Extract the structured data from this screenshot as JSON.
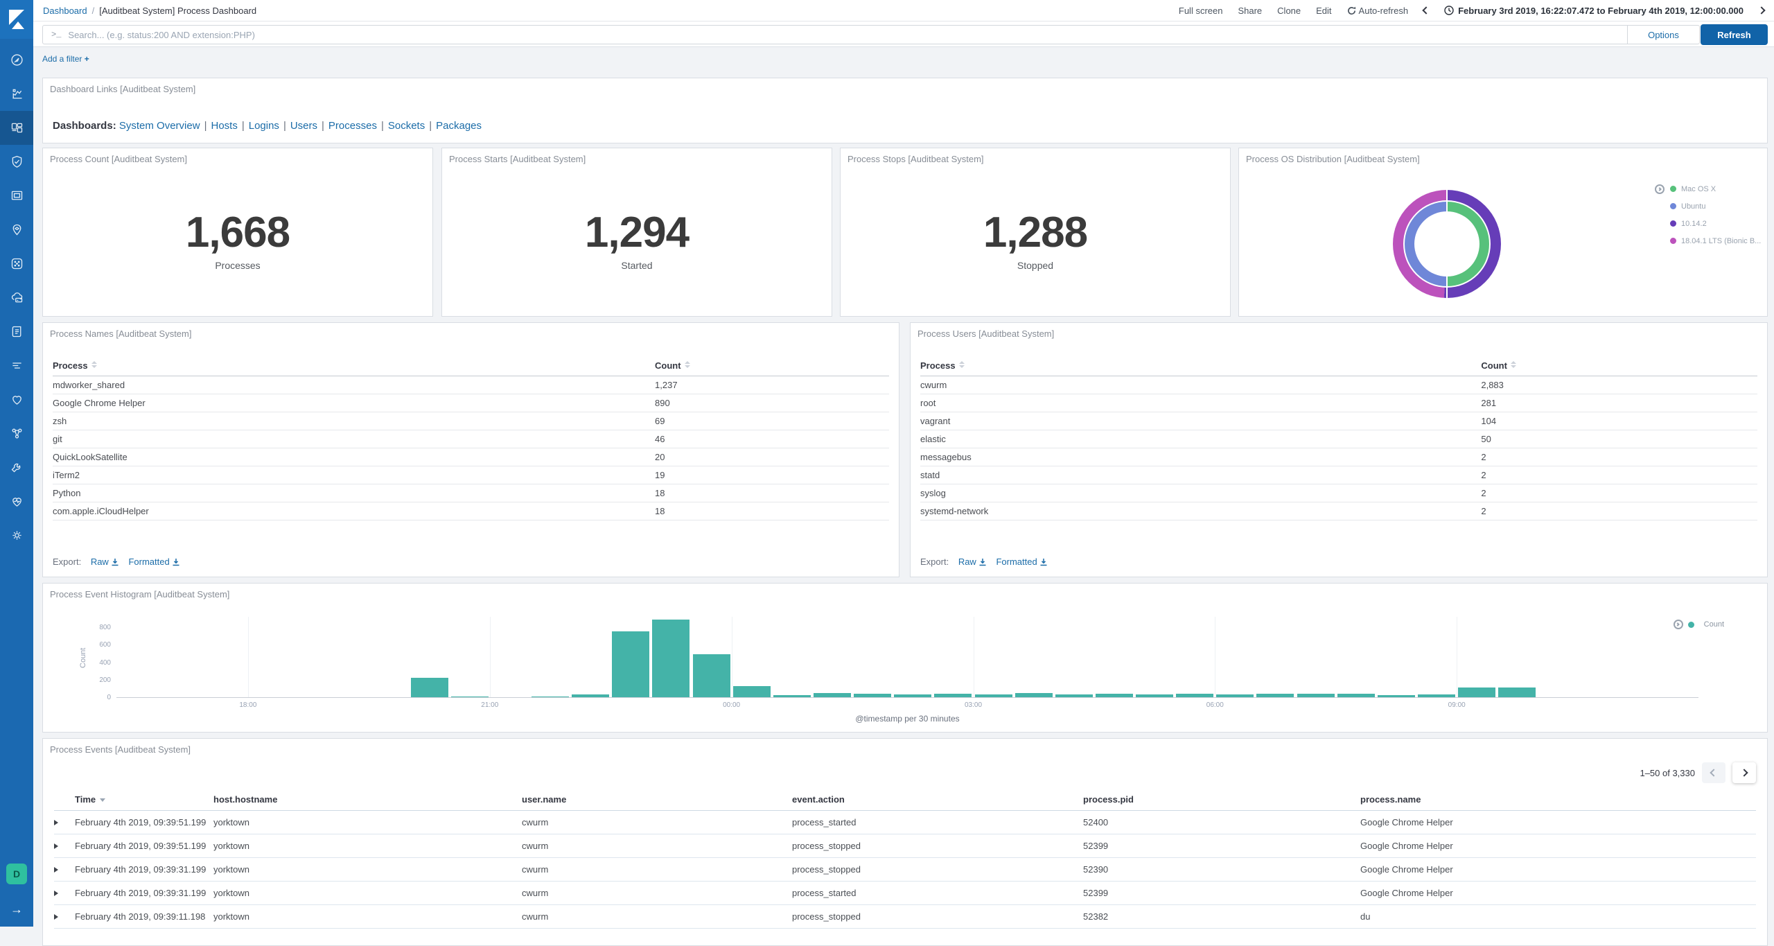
{
  "colors": {
    "accent": "#1b6ca8",
    "button": "#1163a8",
    "nav": "#1b69b1",
    "bar_teal": "#44b3a8"
  },
  "chrome": {
    "breadcrumb": {
      "parent": "Dashboard",
      "separator": "/",
      "current": "[Auditbeat System] Process Dashboard"
    },
    "menu": {
      "full_screen": "Full screen",
      "share": "Share",
      "clone": "Clone",
      "edit": "Edit",
      "auto_refresh": "Auto-refresh"
    },
    "time_range": "February 3rd 2019, 16:22:07.472 to February 4th 2019, 12:00:00.000",
    "search": {
      "placeholder": "Search... (e.g. status:200 AND extension:PHP)",
      "prompt": ">_",
      "options_label": "Options",
      "refresh_label": "Refresh"
    },
    "add_filter_label": "Add a filter",
    "add_filter_plus": "+",
    "space_badge": "D"
  },
  "sidebar": {
    "items": [
      {
        "name": "discover",
        "active": false
      },
      {
        "name": "visualize",
        "active": false
      },
      {
        "name": "dashboard",
        "active": true
      },
      {
        "name": "timelion",
        "active": false
      },
      {
        "name": "canvas",
        "active": false
      },
      {
        "name": "maps",
        "active": false
      },
      {
        "name": "machine-learning",
        "active": false
      },
      {
        "name": "infrastructure",
        "active": false
      },
      {
        "name": "logs",
        "active": false
      },
      {
        "name": "apm",
        "active": false
      },
      {
        "name": "uptime",
        "active": false
      },
      {
        "name": "graph",
        "active": false
      },
      {
        "name": "dev-tools",
        "active": false
      },
      {
        "name": "monitoring",
        "active": false
      },
      {
        "name": "management",
        "active": false
      }
    ]
  },
  "links_panel": {
    "title": "Dashboard Links [Auditbeat System]",
    "label": "Dashboards",
    "colon": ":",
    "separator": "|",
    "links": [
      "System Overview",
      "Hosts",
      "Logins",
      "Users",
      "Processes",
      "Sockets",
      "Packages"
    ]
  },
  "metrics": [
    {
      "title": "Process Count [Auditbeat System]",
      "value": "1,668",
      "label": "Processes"
    },
    {
      "title": "Process Starts [Auditbeat System]",
      "value": "1,294",
      "label": "Started"
    },
    {
      "title": "Process Stops [Auditbeat System]",
      "value": "1,288",
      "label": "Stopped"
    }
  ],
  "os_panel": {
    "title": "Process OS Distribution [Auditbeat System]",
    "legend": [
      {
        "label": "Mac OS X",
        "color": "#57c17b"
      },
      {
        "label": "Ubuntu",
        "color": "#6f87d8"
      },
      {
        "label": "10.14.2",
        "color": "#663db8"
      },
      {
        "label": "18.04.1 LTS (Bionic B...",
        "color": "#bc52bc"
      }
    ],
    "rings": {
      "inner": [
        "#57c17b",
        "#6f87d8"
      ],
      "outer": [
        "#663db8",
        "#bc52bc"
      ],
      "inner_split_deg": 181,
      "outer_split_deg": 183
    }
  },
  "process_names": {
    "title": "Process Names [Auditbeat System]",
    "columns": [
      "Process",
      "Count"
    ],
    "count_col_pos": "72%",
    "rows": [
      [
        "mdworker_shared",
        "1,237"
      ],
      [
        "Google Chrome Helper",
        "890"
      ],
      [
        "zsh",
        "69"
      ],
      [
        "git",
        "46"
      ],
      [
        "QuickLookSatellite",
        "20"
      ],
      [
        "iTerm2",
        "19"
      ],
      [
        "Python",
        "18"
      ],
      [
        "com.apple.iCloudHelper",
        "18"
      ]
    ],
    "export": {
      "label": "Export:",
      "raw": "Raw",
      "formatted": "Formatted"
    }
  },
  "process_users": {
    "title": "Process Users [Auditbeat System]",
    "columns": [
      "Process",
      "Count"
    ],
    "count_col_pos": "67%",
    "rows": [
      [
        "cwurm",
        "2,883"
      ],
      [
        "root",
        "281"
      ],
      [
        "vagrant",
        "104"
      ],
      [
        "elastic",
        "50"
      ],
      [
        "messagebus",
        "2"
      ],
      [
        "statd",
        "2"
      ],
      [
        "syslog",
        "2"
      ],
      [
        "systemd-network",
        "2"
      ]
    ],
    "export": {
      "label": "Export:",
      "raw": "Raw",
      "formatted": "Formatted"
    }
  },
  "chart_data": {
    "type": "bar",
    "title": "Process Event Histogram [Auditbeat System]",
    "xlabel": "@timestamp per 30 minutes",
    "ylabel": "Count",
    "legend": {
      "name": "Count",
      "color": "#44b3a8",
      "position": "top-right"
    },
    "grid": "vertical-faint",
    "ylim": [
      0,
      920
    ],
    "yticks": [
      0,
      200,
      400,
      600,
      800
    ],
    "x_domain": {
      "start": "16:22",
      "end": "12:00",
      "span_minutes": 1178
    },
    "bucket_minutes": 30,
    "xticks": [
      "18:00",
      "21:00",
      "00:00",
      "03:00",
      "06:00",
      "09:00"
    ],
    "buckets": [
      [
        "20:00",
        220
      ],
      [
        "20:30",
        12
      ],
      [
        "21:30",
        6
      ],
      [
        "22:00",
        32
      ],
      [
        "22:30",
        755
      ],
      [
        "23:00",
        890
      ],
      [
        "23:30",
        490
      ],
      [
        "00:00",
        130
      ],
      [
        "00:30",
        26
      ],
      [
        "01:00",
        45
      ],
      [
        "01:30",
        38
      ],
      [
        "02:00",
        35
      ],
      [
        "02:30",
        40
      ],
      [
        "03:00",
        30
      ],
      [
        "03:30",
        46
      ],
      [
        "04:00",
        34
      ],
      [
        "04:30",
        40
      ],
      [
        "05:00",
        34
      ],
      [
        "05:30",
        42
      ],
      [
        "06:00",
        30
      ],
      [
        "06:30",
        40
      ],
      [
        "07:00",
        38
      ],
      [
        "07:30",
        40
      ],
      [
        "08:00",
        28
      ],
      [
        "08:30",
        34
      ],
      [
        "09:00",
        115
      ],
      [
        "09:30",
        110
      ]
    ]
  },
  "events_panel": {
    "title": "Process Events [Auditbeat System]",
    "pagination": "1–50 of 3,330",
    "columns": [
      "Time",
      "host.hostname",
      "user.name",
      "event.action",
      "process.pid",
      "process.name"
    ],
    "sorted_column": "Time",
    "rows": [
      [
        "February 4th 2019, 09:39:51.199",
        "yorktown",
        "cwurm",
        "process_started",
        "52400",
        "Google Chrome Helper"
      ],
      [
        "February 4th 2019, 09:39:51.199",
        "yorktown",
        "cwurm",
        "process_stopped",
        "52399",
        "Google Chrome Helper"
      ],
      [
        "February 4th 2019, 09:39:31.199",
        "yorktown",
        "cwurm",
        "process_stopped",
        "52390",
        "Google Chrome Helper"
      ],
      [
        "February 4th 2019, 09:39:31.199",
        "yorktown",
        "cwurm",
        "process_started",
        "52399",
        "Google Chrome Helper"
      ],
      [
        "February 4th 2019, 09:39:11.198",
        "yorktown",
        "cwurm",
        "process_stopped",
        "52382",
        "du"
      ]
    ]
  }
}
